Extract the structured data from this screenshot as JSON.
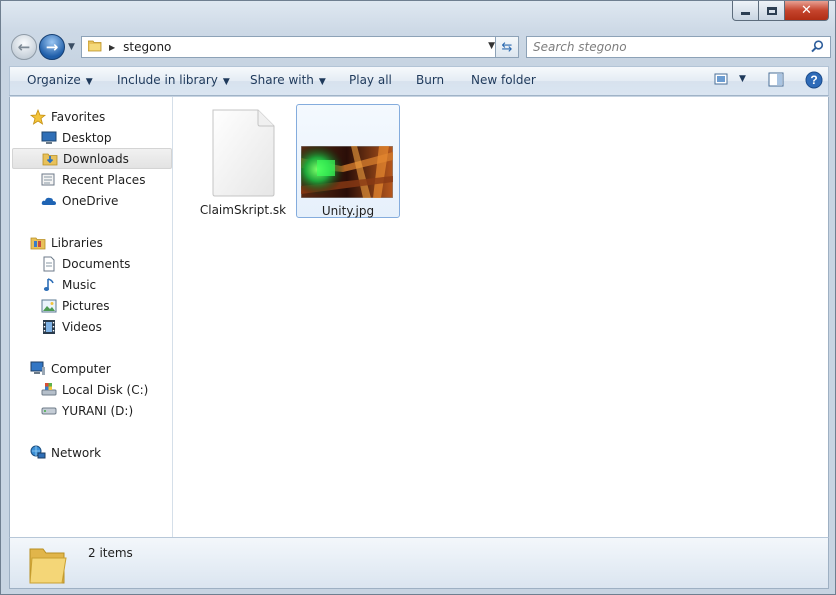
{
  "window": {
    "minimize_label": "",
    "close_label": "✕"
  },
  "address_bar": {
    "crumb": "stegono",
    "search_placeholder": "Search stegono"
  },
  "toolbar": {
    "organize": "Organize",
    "include_in_library": "Include in library",
    "share_with": "Share with",
    "play_all": "Play all",
    "burn": "Burn",
    "new_folder": "New folder",
    "help": "?"
  },
  "nav_pane": {
    "favorites": {
      "label": "Favorites",
      "items": [
        {
          "label": "Desktop",
          "icon": "desktop-icon"
        },
        {
          "label": "Downloads",
          "icon": "downloads-icon",
          "selected": true
        },
        {
          "label": "Recent Places",
          "icon": "recent-places-icon"
        },
        {
          "label": "OneDrive",
          "icon": "onedrive-icon"
        }
      ]
    },
    "libraries": {
      "label": "Libraries",
      "items": [
        {
          "label": "Documents",
          "icon": "documents-icon"
        },
        {
          "label": "Music",
          "icon": "music-icon"
        },
        {
          "label": "Pictures",
          "icon": "pictures-icon"
        },
        {
          "label": "Videos",
          "icon": "videos-icon"
        }
      ]
    },
    "computer": {
      "label": "Computer",
      "items": [
        {
          "label": "Local Disk (C:)",
          "icon": "local-disk-icon"
        },
        {
          "label": "YURANI (D:)",
          "icon": "removable-drive-icon"
        }
      ]
    },
    "network": {
      "label": "Network"
    }
  },
  "files": [
    {
      "name": "ClaimSkript.sk",
      "icon": "generic-file-icon",
      "selected": false
    },
    {
      "name": "Unity.jpg",
      "icon": "image-thumbnail",
      "selected": true
    }
  ],
  "status_bar": {
    "item_count": "2 items"
  },
  "colors": {
    "accent": "#1e395b",
    "selection_border": "#84acdd",
    "close_button": "#c5442d"
  }
}
